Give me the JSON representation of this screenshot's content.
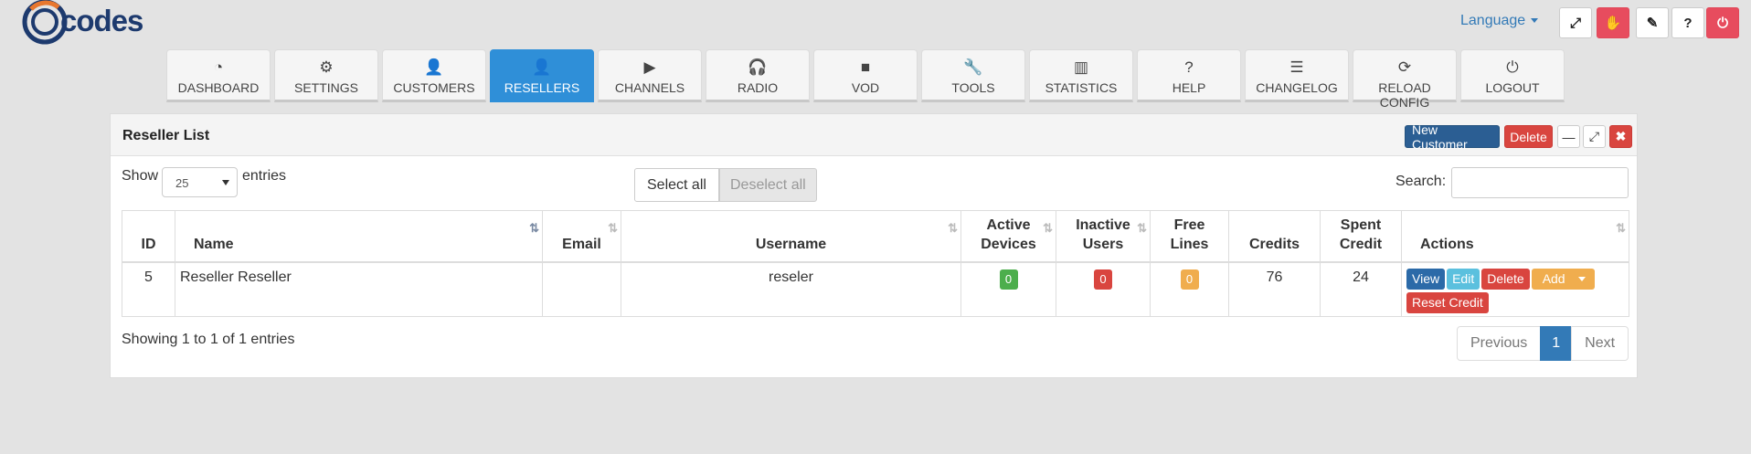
{
  "brand": {
    "logo_text": "codes"
  },
  "topbar": {
    "language_label": "Language",
    "buttons": [
      {
        "icon": "fullscreen-icon",
        "glyph": "⤢"
      },
      {
        "icon": "hand-icon",
        "glyph": "✋"
      },
      {
        "icon": "ticket-icon",
        "glyph": "✎"
      },
      {
        "icon": "help-icon",
        "glyph": "?"
      },
      {
        "icon": "power-icon",
        "glyph": "⏻"
      }
    ]
  },
  "nav": {
    "tabs": [
      {
        "label": "DASHBOARD",
        "icon": "dashboard-icon",
        "glyph": "◔"
      },
      {
        "label": "SETTINGS",
        "icon": "gear-icon",
        "glyph": "⚙"
      },
      {
        "label": "CUSTOMERS",
        "icon": "user-icon",
        "glyph": "👤"
      },
      {
        "label": "RESELLERS",
        "icon": "user-icon",
        "glyph": "👤",
        "active": true
      },
      {
        "label": "CHANNELS",
        "icon": "play-icon",
        "glyph": "▶"
      },
      {
        "label": "RADIO",
        "icon": "headphones-icon",
        "glyph": "🎧"
      },
      {
        "label": "VOD",
        "icon": "video-camera-icon",
        "glyph": "■"
      },
      {
        "label": "TOOLS",
        "icon": "wrench-icon",
        "glyph": "🔧"
      },
      {
        "label": "STATISTICS",
        "icon": "bar-chart-icon",
        "glyph": "▥"
      },
      {
        "label": "HELP",
        "icon": "question-icon",
        "glyph": "?"
      },
      {
        "label": "CHANGELOG",
        "icon": "list-icon",
        "glyph": "☰"
      },
      {
        "label": "RELOAD CONFIG",
        "icon": "refresh-icon",
        "glyph": "⟳"
      },
      {
        "label": "LOGOUT",
        "icon": "power-icon",
        "glyph": "⏻"
      }
    ]
  },
  "panel": {
    "title": "Reseller List",
    "new_customer": "New Customer",
    "delete": "Delete",
    "minimize_glyph": "—",
    "expand_glyph": "⤢",
    "close_glyph": "✖"
  },
  "controls": {
    "show_label": "Show",
    "page_size": "25",
    "entries_label": "entries",
    "select_all": "Select all",
    "deselect_all": "Deselect all",
    "search_label": "Search:",
    "search_value": ""
  },
  "table": {
    "columns": {
      "id": "ID",
      "name": "Name",
      "email": "Email",
      "username": "Username",
      "active_devices_1": "Active",
      "active_devices_2": "Devices",
      "inactive_users_1": "Inactive",
      "inactive_users_2": "Users",
      "free_lines_1": "Free",
      "free_lines_2": "Lines",
      "credits": "Credits",
      "spent_credit_1": "Spent",
      "spent_credit_2": "Credit",
      "actions": "Actions"
    },
    "rows": [
      {
        "id": "5",
        "name": "Reseller Reseller",
        "email": "",
        "username": "reseler",
        "active_devices": "0",
        "inactive_users": "0",
        "free_lines": "0",
        "credits": "76",
        "spent_credit": "24",
        "actions": {
          "view": "View",
          "edit": "Edit",
          "delete": "Delete",
          "add": "Add",
          "reset": "Reset Credit"
        }
      }
    ]
  },
  "footer": {
    "showing": "Showing 1 to 1 of 1 entries",
    "previous": "Previous",
    "current_page": "1",
    "next": "Next"
  }
}
